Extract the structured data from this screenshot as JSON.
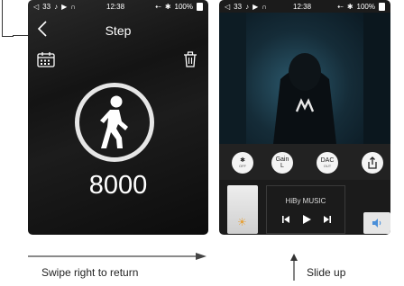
{
  "left_screen": {
    "status": {
      "volume": "33",
      "time": "12:38",
      "battery": "100%"
    },
    "title": "Step",
    "step_count": "8000"
  },
  "right_screen": {
    "status": {
      "volume": "33",
      "time": "12:38",
      "battery": "100%"
    },
    "controls": {
      "bluetooth": {
        "label": "OFF"
      },
      "gain": {
        "label": "Gain",
        "value": "L"
      },
      "dac": {
        "label": "DAC",
        "value": "OUT"
      }
    },
    "player": {
      "title": "HiBy MUSIC"
    }
  },
  "captions": {
    "swipe": "Swipe right to return",
    "slide": "Slide up"
  },
  "colors": {
    "screen_bg": "#1b1b1b",
    "accent_white": "#ffffff",
    "ring": "#e6e6e6"
  }
}
